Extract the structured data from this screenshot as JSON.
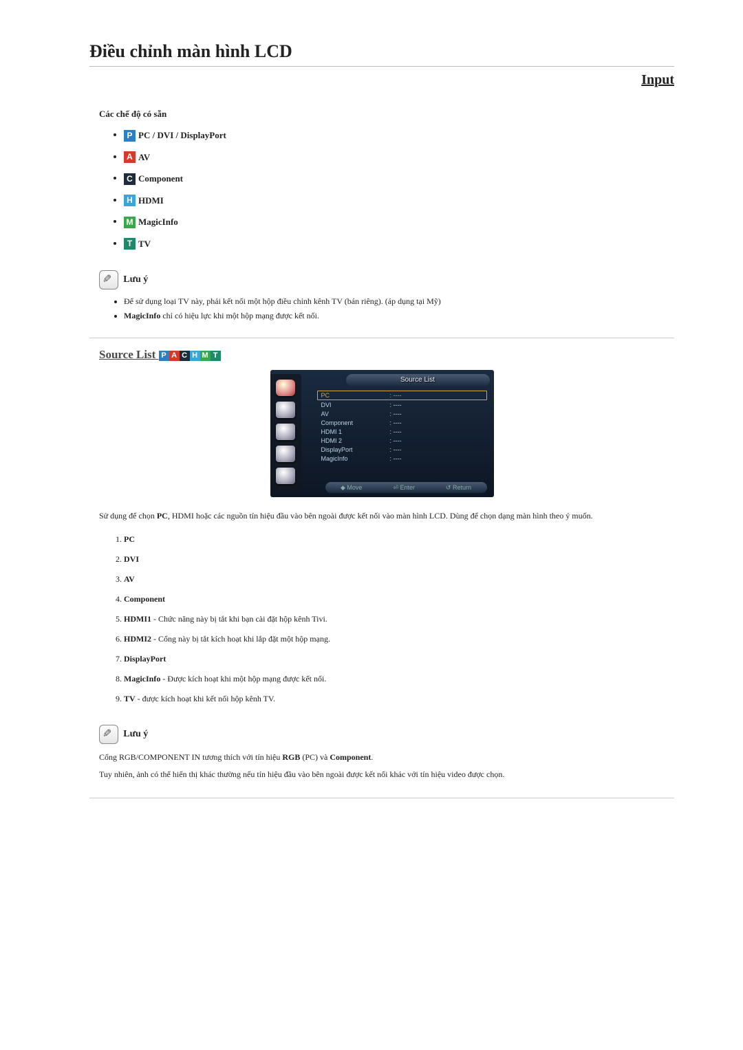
{
  "page_title": "Điều chỉnh màn hình LCD",
  "section_input": "Input",
  "modes_heading": "Các chế độ có sẵn",
  "modes": [
    {
      "badge": "P",
      "label": "PC / DVI / DisplayPort"
    },
    {
      "badge": "A",
      "label": "AV"
    },
    {
      "badge": "C",
      "label": "Component"
    },
    {
      "badge": "H",
      "label": "HDMI"
    },
    {
      "badge": "M",
      "label": "MagicInfo"
    },
    {
      "badge": "T",
      "label": "TV"
    }
  ],
  "note1_label": "Lưu ý",
  "note1_items": [
    "Để sử dụng loại TV này, phải kết nối một hộp điều chỉnh kênh TV (bán riêng). (áp dụng tại Mỹ)",
    "<b>MagicInfo</b> chỉ có hiệu lực khi một hộp mạng được kết nối."
  ],
  "source_list_heading": "Source List",
  "osd": {
    "title": "Source List",
    "rows": [
      {
        "name": "PC",
        "val": "----",
        "selected": true
      },
      {
        "name": "DVI",
        "val": "----"
      },
      {
        "name": "AV",
        "val": "----"
      },
      {
        "name": "Component",
        "val": "----"
      },
      {
        "name": "HDMI 1",
        "val": "----"
      },
      {
        "name": "HDMI 2",
        "val": "----"
      },
      {
        "name": "DisplayPort",
        "val": "----"
      },
      {
        "name": "MagicInfo",
        "val": "----"
      }
    ],
    "footer": {
      "move": "Move",
      "enter": "Enter",
      "return": "Return"
    }
  },
  "usage_text": "Sử dụng để chọn <b>PC</b>, HDMI hoặc các nguồn tín hiệu đầu vào bên ngoài được kết nối vào màn hình LCD. Dùng để chọn dạng màn hình theo ý muốn.",
  "source_ol": [
    "<b>PC</b>",
    "<b>DVI</b>",
    "<b>AV</b>",
    "<b>Component</b>",
    "<b>HDMI1</b> - Chức năng này bị tắt khi bạn cài đặt hộp kênh Tivi.",
    "<b>HDMI2</b> - Cổng này bị tắt kích hoạt khi lắp đặt một hộp mạng.",
    "<b>DisplayPort</b>",
    "<b>MagicInfo</b> - Được kích hoạt khi một hộp mạng được kết nối.",
    "<b>TV</b> - được kích hoạt khi kết nối hộp kênh TV."
  ],
  "note2_label": "Lưu ý",
  "note2_p1": "Cổng RGB/COMPONENT IN tương thích với tín hiệu <b>RGB</b> (PC) và <b>Component</b>.",
  "note2_p2": "Tuy nhiên, ảnh có thể hiển thị khác thường nếu tín hiệu đầu vào bên ngoài được kết nối khác với tín hiệu video được chọn."
}
